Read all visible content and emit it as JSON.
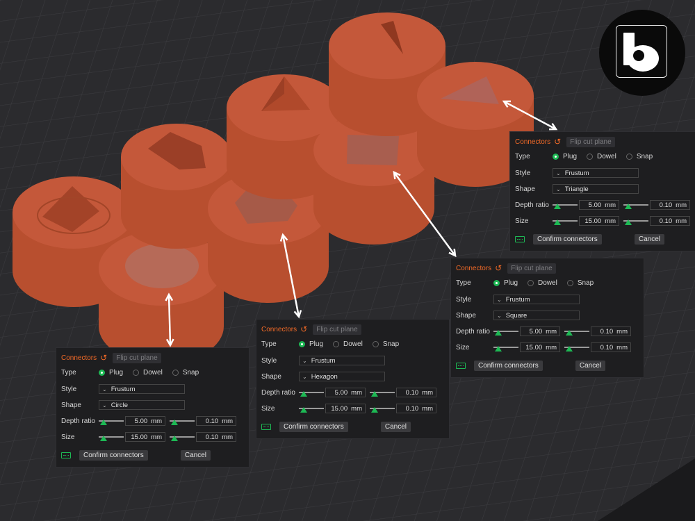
{
  "colors": {
    "background": "#2b2b2e",
    "plug": "#b84f2f",
    "plug_top": "#c4583a",
    "accent": "#f26a27",
    "active": "#1db954"
  },
  "logo": {
    "name": "bambu-lab-logo"
  },
  "parts": [
    {
      "shape": "cone"
    },
    {
      "shape": "circle"
    },
    {
      "shape": "pyramid"
    },
    {
      "shape": "hexagon"
    },
    {
      "shape": "triangle-pyramid"
    },
    {
      "shape": "square"
    },
    {
      "shape": "wedge"
    },
    {
      "shape": "triangle"
    }
  ],
  "panels": [
    {
      "id": "circle",
      "header": "Connectors",
      "flip": "Flip cut plane",
      "type_label": "Type",
      "types": [
        "Plug",
        "Dowel",
        "Snap"
      ],
      "selected_type": "Plug",
      "style_label": "Style",
      "style": "Frustum",
      "shape_label": "Shape",
      "shape": "Circle",
      "depth_label": "Depth ratio",
      "depth": "5.00",
      "depth_tol": "0.10",
      "size_label": "Size",
      "size": "15.00",
      "size_tol": "0.10",
      "unit": "mm",
      "confirm": "Confirm connectors",
      "cancel": "Cancel"
    },
    {
      "id": "hexagon",
      "header": "Connectors",
      "flip": "Flip cut plane",
      "type_label": "Type",
      "types": [
        "Plug",
        "Dowel",
        "Snap"
      ],
      "selected_type": "Plug",
      "style_label": "Style",
      "style": "Frustum",
      "shape_label": "Shape",
      "shape": "Hexagon",
      "depth_label": "Depth ratio",
      "depth": "5.00",
      "depth_tol": "0.10",
      "size_label": "Size",
      "size": "15.00",
      "size_tol": "0.10",
      "unit": "mm",
      "confirm": "Confirm connectors",
      "cancel": "Cancel"
    },
    {
      "id": "square",
      "header": "Connectors",
      "flip": "Flip cut plane",
      "type_label": "Type",
      "types": [
        "Plug",
        "Dowel",
        "Snap"
      ],
      "selected_type": "Plug",
      "style_label": "Style",
      "style": "Frustum",
      "shape_label": "Shape",
      "shape": "Square",
      "depth_label": "Depth ratio",
      "depth": "5.00",
      "depth_tol": "0.10",
      "size_label": "Size",
      "size": "15.00",
      "size_tol": "0.10",
      "unit": "mm",
      "confirm": "Confirm connectors",
      "cancel": "Cancel"
    },
    {
      "id": "triangle",
      "header": "Connectors",
      "flip": "Flip cut plane",
      "type_label": "Type",
      "types": [
        "Plug",
        "Dowel",
        "Snap"
      ],
      "selected_type": "Plug",
      "style_label": "Style",
      "style": "Frustum",
      "shape_label": "Shape",
      "shape": "Triangle",
      "depth_label": "Depth ratio",
      "depth": "5.00",
      "depth_tol": "0.10",
      "size_label": "Size",
      "size": "15.00",
      "size_tol": "0.10",
      "unit": "mm",
      "confirm": "Confirm connectors",
      "cancel": "Cancel"
    }
  ]
}
